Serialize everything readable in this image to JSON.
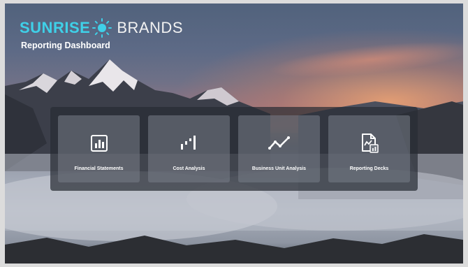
{
  "brand": {
    "name_part1": "SUN",
    "name_part2": "RISE",
    "name_part3": "BRANDS",
    "icon": "sun-icon",
    "accent_color": "#3fd0e8"
  },
  "subtitle": "Reporting Dashboard",
  "tiles": [
    {
      "label": "Financial Statements",
      "icon": "bar-chart-icon"
    },
    {
      "label": "Cost Analysis",
      "icon": "step-chart-icon"
    },
    {
      "label": "Business Unit Analysis",
      "icon": "line-chart-icon"
    },
    {
      "label": "Reporting Decks",
      "icon": "report-document-icon"
    }
  ]
}
